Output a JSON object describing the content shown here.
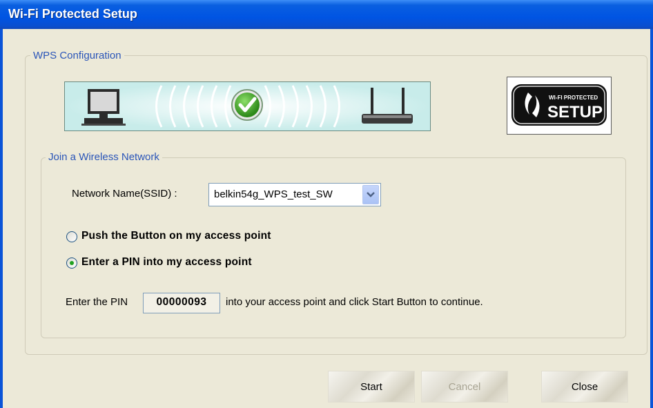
{
  "window": {
    "title": "Wi-Fi Protected Setup"
  },
  "wps_group": {
    "label": "WPS Configuration"
  },
  "logo": {
    "top_text": "WI-FI PROTECTED",
    "main_text": "SETUP"
  },
  "join_group": {
    "label": "Join a Wireless Network"
  },
  "network": {
    "label": "Network Name(SSID) :",
    "selected": "belkin54g_WPS_test_SW"
  },
  "methods": [
    {
      "label": "Push the Button on my access point",
      "selected": false
    },
    {
      "label": "Enter a PIN into my access point",
      "selected": true
    }
  ],
  "pin": {
    "prefix": "Enter the PIN",
    "value": "00000093",
    "suffix": "into your access point and click Start Button to continue."
  },
  "buttons": {
    "start": "Start",
    "cancel": "Cancel",
    "close": "Close"
  }
}
